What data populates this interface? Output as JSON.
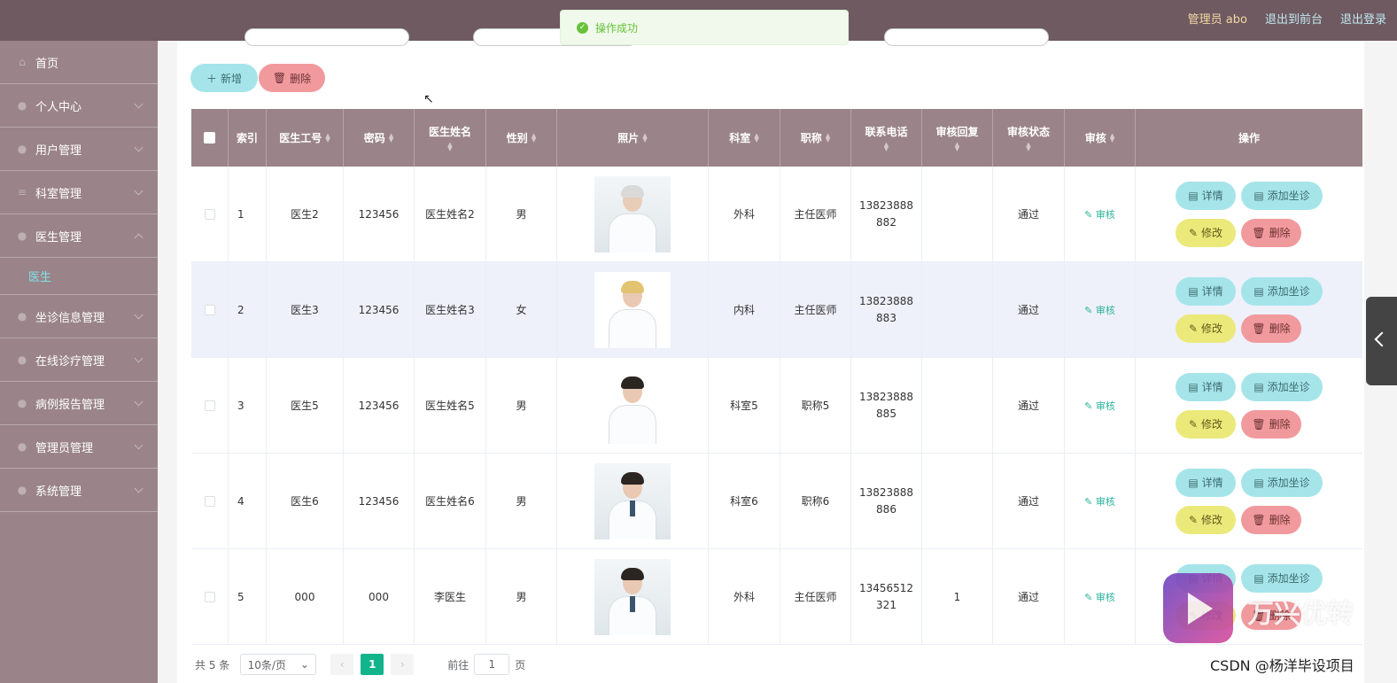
{
  "header": {
    "admin_label": "管理员 abo",
    "to_front": "退出到前台",
    "logout": "退出登录"
  },
  "sidebar": {
    "items": [
      {
        "label": "首页",
        "icon": "home-icon"
      },
      {
        "label": "个人中心",
        "icon": "user-icon"
      },
      {
        "label": "用户管理",
        "icon": "users-icon"
      },
      {
        "label": "科室管理",
        "icon": "list-icon"
      },
      {
        "label": "医生管理",
        "icon": "doctor-icon"
      },
      {
        "label": "坐诊信息管理",
        "icon": "calendar-icon"
      },
      {
        "label": "在线诊疗管理",
        "icon": "chat-icon"
      },
      {
        "label": "病例报告管理",
        "icon": "report-icon"
      },
      {
        "label": "管理员管理",
        "icon": "admin-icon"
      },
      {
        "label": "系统管理",
        "icon": "gear-icon"
      }
    ],
    "active_sub": "医生"
  },
  "toolbar": {
    "add_label": "新增",
    "delete_label": "删除"
  },
  "toast": {
    "message": "操作成功"
  },
  "table": {
    "headers": {
      "index": "索引",
      "doctor_no": "医生工号",
      "password": "密码",
      "doctor_name": "医生姓名",
      "gender": "性别",
      "photo": "照片",
      "department": "科室",
      "title": "职称",
      "phone": "联系电话",
      "audit_reply": "审核回复",
      "audit_status": "审核状态",
      "audit": "审核",
      "actions": "操作"
    },
    "rows": [
      {
        "index": "1",
        "doctor_no": "医生2",
        "password": "123456",
        "doctor_name": "医生姓名2",
        "gender": "男",
        "department": "外科",
        "title": "主任医师",
        "phone_a": "13823888",
        "phone_b": "882",
        "audit_reply": "",
        "audit_status": "通过"
      },
      {
        "index": "2",
        "doctor_no": "医生3",
        "password": "123456",
        "doctor_name": "医生姓名3",
        "gender": "女",
        "department": "内科",
        "title": "主任医师",
        "phone_a": "13823888",
        "phone_b": "883",
        "audit_reply": "",
        "audit_status": "通过"
      },
      {
        "index": "3",
        "doctor_no": "医生5",
        "password": "123456",
        "doctor_name": "医生姓名5",
        "gender": "男",
        "department": "科室5",
        "title": "职称5",
        "phone_a": "13823888",
        "phone_b": "885",
        "audit_reply": "",
        "audit_status": "通过"
      },
      {
        "index": "4",
        "doctor_no": "医生6",
        "password": "123456",
        "doctor_name": "医生姓名6",
        "gender": "男",
        "department": "科室6",
        "title": "职称6",
        "phone_a": "13823888",
        "phone_b": "886",
        "audit_reply": "",
        "audit_status": "通过"
      },
      {
        "index": "5",
        "doctor_no": "000",
        "password": "000",
        "doctor_name": "李医生",
        "gender": "男",
        "department": "外科",
        "title": "主任医师",
        "phone_a": "13456512",
        "phone_b": "321",
        "audit_reply": "1",
        "audit_status": "通过"
      }
    ],
    "row_actions": {
      "audit": "审核",
      "detail": "详情",
      "add_consult": "添加坐诊",
      "edit": "修改",
      "remove": "删除"
    }
  },
  "pagination": {
    "total": "共 5 条",
    "page_size": "10条/页",
    "current": "1",
    "goto_label": "前往",
    "goto_value": "1",
    "page_suffix": "页"
  },
  "watermark": {
    "brand": "万兴优转",
    "credit": "CSDN @杨洋毕设项目"
  },
  "colors": {
    "header_bg": "#6f5a61",
    "sidebar_bg": "#9a8489",
    "accent_cyan": "#a5e5ea",
    "accent_red": "#f19a9e",
    "accent_yellow": "#ebe97a",
    "page_active": "#12b48c"
  }
}
